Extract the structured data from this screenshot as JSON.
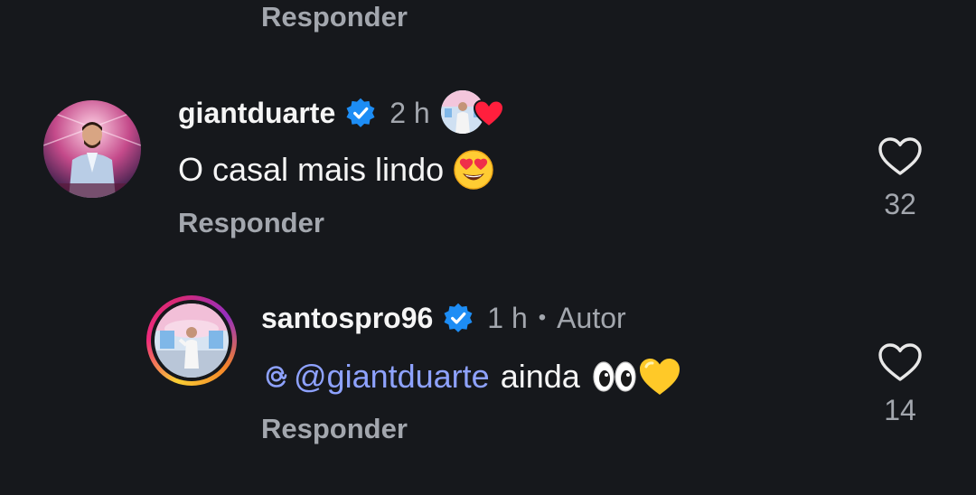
{
  "top_reply": {
    "label": "Responder"
  },
  "comments": [
    {
      "username": "giantduarte",
      "verified": true,
      "time": "2 h",
      "text": "O casal mais lindo",
      "text_emoji": "heart-eyes-emoji",
      "reply_label": "Responder",
      "likes": "32",
      "liked_by_author": true
    },
    {
      "username": "santospro96",
      "verified": true,
      "time": "1 h",
      "author_label": "Autor",
      "mention": "@giantduarte",
      "text": "ainda",
      "text_emojis": [
        "eyes-emoji",
        "yellow-heart-emoji"
      ],
      "reply_label": "Responder",
      "likes": "14",
      "has_story": true
    }
  ],
  "colors": {
    "background": "#16181c",
    "primary_text": "#f5f5f5",
    "secondary_text": "#a3a7ae",
    "mention": "#8ea2ff",
    "verified_badge": "#1d8df5",
    "liked_heart": "#ff1f3d"
  }
}
